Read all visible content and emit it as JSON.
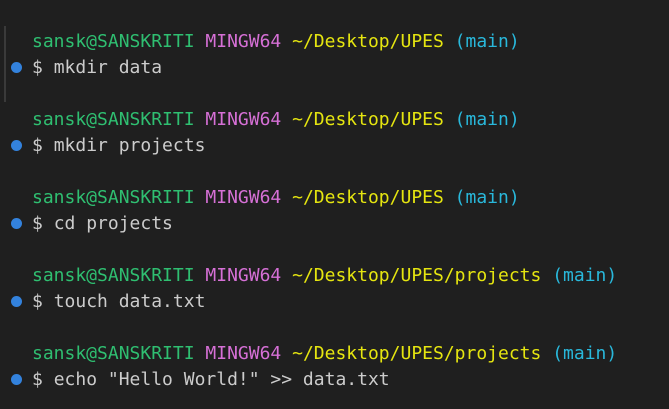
{
  "colors": {
    "background": "#1f1f1f",
    "user_host": "#2fbf71",
    "system": "#d670d6",
    "path": "#e5e510",
    "branch": "#29b8db",
    "command_text": "#cccccc",
    "status_dot": "#3794ff"
  },
  "icons": {
    "status_dot": "circle-dot-icon"
  },
  "entries": [
    {
      "user_host": "sansk@SANSKRITI",
      "system": "MINGW64",
      "path": "~/Desktop/UPES",
      "branch": "(main)",
      "prompt_symbol": "$",
      "command": "mkdir data"
    },
    {
      "user_host": "sansk@SANSKRITI",
      "system": "MINGW64",
      "path": "~/Desktop/UPES",
      "branch": "(main)",
      "prompt_symbol": "$",
      "command": "mkdir projects"
    },
    {
      "user_host": "sansk@SANSKRITI",
      "system": "MINGW64",
      "path": "~/Desktop/UPES",
      "branch": "(main)",
      "prompt_symbol": "$",
      "command": "cd projects"
    },
    {
      "user_host": "sansk@SANSKRITI",
      "system": "MINGW64",
      "path": "~/Desktop/UPES/projects",
      "branch": "(main)",
      "prompt_symbol": "$",
      "command": "touch data.txt"
    },
    {
      "user_host": "sansk@SANSKRITI",
      "system": "MINGW64",
      "path": "~/Desktop/UPES/projects",
      "branch": "(main)",
      "prompt_symbol": "$",
      "command": "echo \"Hello World!\" >> data.txt"
    }
  ]
}
